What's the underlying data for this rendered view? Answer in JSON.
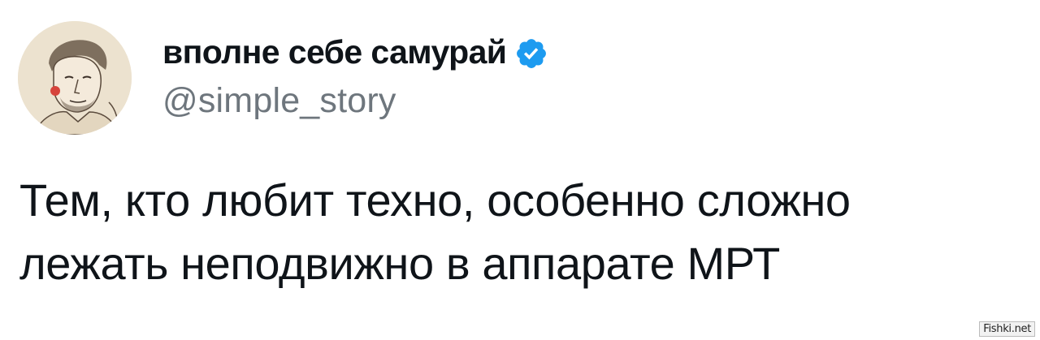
{
  "tweet": {
    "author": {
      "display_name": "вполне себе самурай",
      "handle": "@simple_story",
      "verified": true,
      "avatar_icon": "sketch-portrait-avatar",
      "verified_icon": "verified-badge-icon",
      "verified_color": "#1d9bf0"
    },
    "text": "Тем, кто любит техно, особенно сложно\nлежать неподвижно в аппарате МРТ"
  },
  "watermark": {
    "text": "Fishki.net"
  }
}
